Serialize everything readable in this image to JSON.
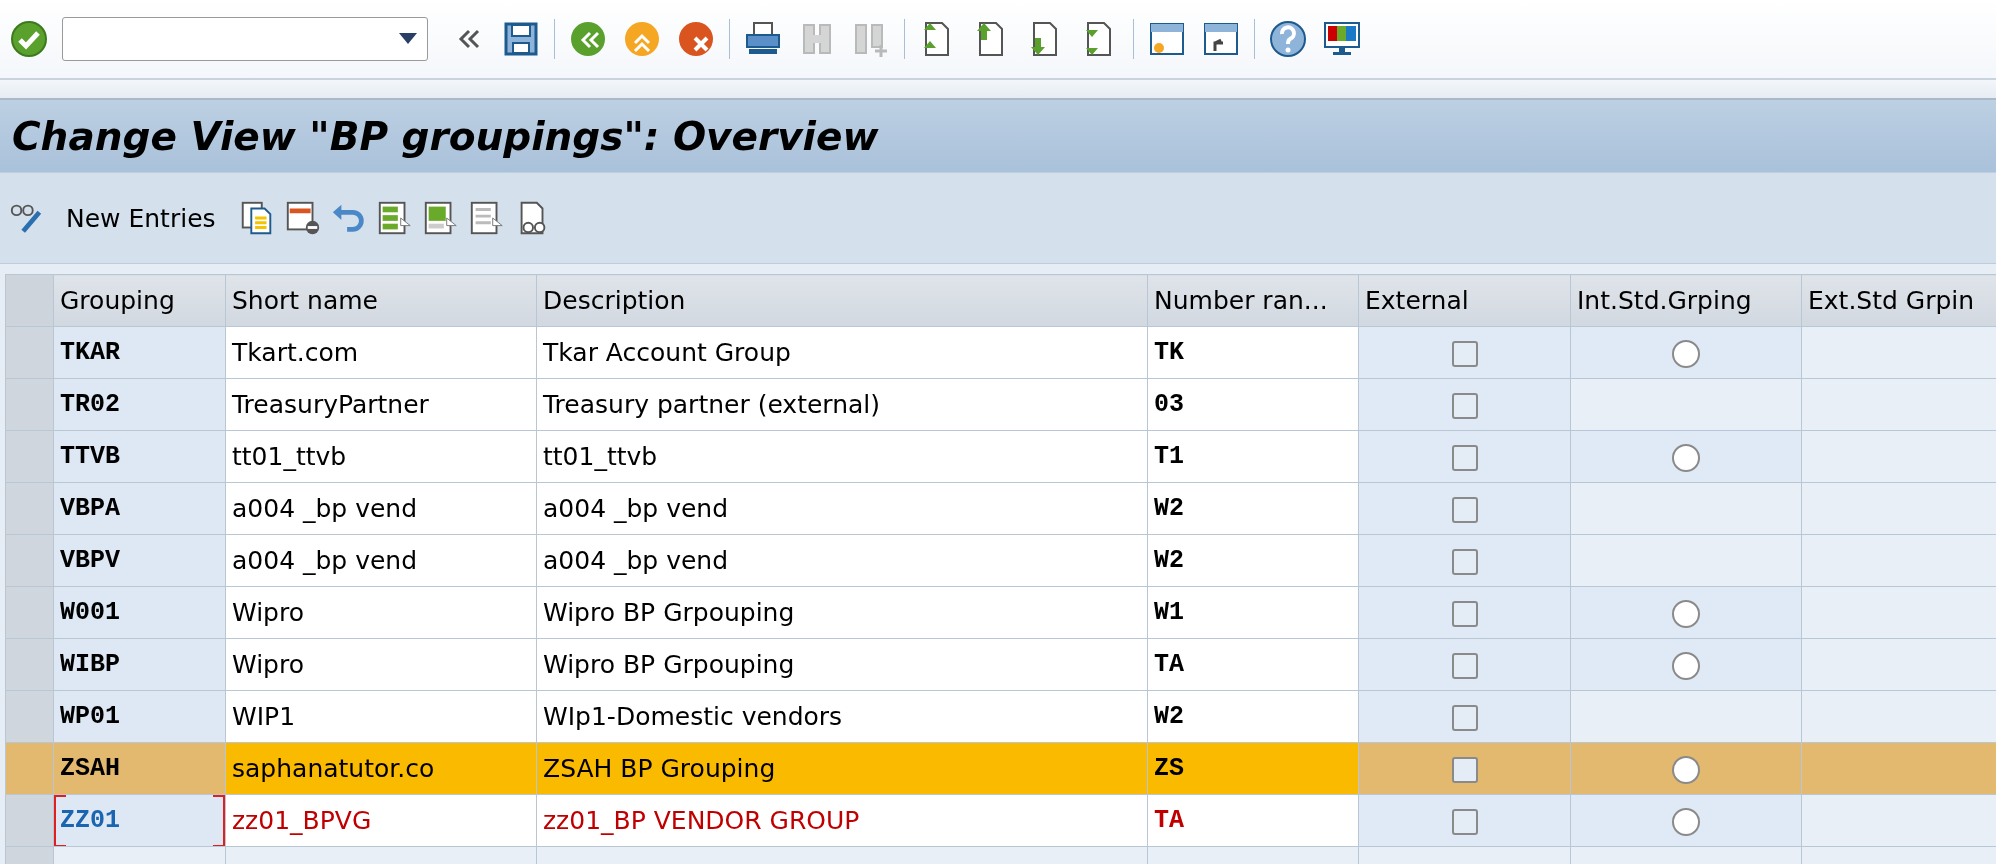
{
  "toolbar": {
    "items": [
      {
        "kind": "enter",
        "disabled": false
      },
      {
        "kind": "command_field"
      },
      {
        "kind": "collapse",
        "disabled": false
      },
      {
        "kind": "save",
        "disabled": false
      },
      {
        "kind": "separator"
      },
      {
        "kind": "back",
        "disabled": false
      },
      {
        "kind": "exit",
        "disabled": false
      },
      {
        "kind": "cancel",
        "disabled": false
      },
      {
        "kind": "separator"
      },
      {
        "kind": "print",
        "disabled": false
      },
      {
        "kind": "find",
        "disabled": true
      },
      {
        "kind": "find_next",
        "disabled": true
      },
      {
        "kind": "separator"
      },
      {
        "kind": "first_page",
        "disabled": false
      },
      {
        "kind": "prev_page",
        "disabled": false
      },
      {
        "kind": "next_page",
        "disabled": false
      },
      {
        "kind": "last_page",
        "disabled": false
      },
      {
        "kind": "separator"
      },
      {
        "kind": "new_session",
        "disabled": false
      },
      {
        "kind": "shortcut",
        "disabled": false
      },
      {
        "kind": "separator"
      },
      {
        "kind": "help",
        "disabled": false
      },
      {
        "kind": "layout",
        "disabled": false
      }
    ]
  },
  "title": "Change View \"BP groupings\": Overview",
  "app_toolbar": {
    "items": [
      {
        "kind": "display_change"
      },
      {
        "kind": "text_button",
        "label": "New Entries"
      },
      {
        "kind": "copy"
      },
      {
        "kind": "delete"
      },
      {
        "kind": "undo"
      },
      {
        "kind": "select_all"
      },
      {
        "kind": "select_block"
      },
      {
        "kind": "deselect_all"
      },
      {
        "kind": "where_used"
      }
    ]
  },
  "table": {
    "columns": [
      "Grouping",
      "Short name",
      "Description",
      "Number ran...",
      "External",
      "Int.Std.Grping",
      "Ext.Std Grpin"
    ],
    "rows": [
      {
        "grouping": "TKAR",
        "short_name": "Tkart.com",
        "description": "Tkar Account Group",
        "number_range": "TK",
        "external": false,
        "int_std": {
          "selected": false
        },
        "selected": false,
        "changed": false,
        "focused": false
      },
      {
        "grouping": "TR02",
        "short_name": "TreasuryPartner",
        "description": "Treasury partner (external)",
        "number_range": "03",
        "external": false,
        "selected": false,
        "changed": false,
        "focused": false
      },
      {
        "grouping": "TTVB",
        "short_name": "tt01_ttvb",
        "description": "tt01_ttvb",
        "number_range": "T1",
        "external": false,
        "int_std": {
          "selected": false
        },
        "selected": false,
        "changed": false,
        "focused": false
      },
      {
        "grouping": "VBPA",
        "short_name": "a004 _bp vend",
        "description": "a004 _bp vend",
        "number_range": "W2",
        "external": false,
        "selected": false,
        "changed": false,
        "focused": false
      },
      {
        "grouping": "VBPV",
        "short_name": "a004 _bp vend",
        "description": "a004 _bp vend",
        "number_range": "W2",
        "external": false,
        "selected": false,
        "changed": false,
        "focused": false
      },
      {
        "grouping": "W001",
        "short_name": "Wipro",
        "description": "Wipro BP Grpouping",
        "number_range": "W1",
        "external": false,
        "int_std": {
          "selected": false
        },
        "selected": false,
        "changed": false,
        "focused": false
      },
      {
        "grouping": "WIBP",
        "short_name": "Wipro",
        "description": "Wipro BP Grpouping",
        "number_range": "TA",
        "external": false,
        "int_std": {
          "selected": false
        },
        "selected": false,
        "changed": false,
        "focused": false
      },
      {
        "grouping": "WP01",
        "short_name": "WIP1",
        "description": "WIp1-Domestic vendors",
        "number_range": "W2",
        "external": false,
        "selected": false,
        "changed": false,
        "focused": false
      },
      {
        "grouping": "ZSAH",
        "short_name": "saphanatutor.co",
        "description": "ZSAH BP Grouping",
        "number_range": "ZS",
        "external": false,
        "int_std": {
          "selected": false
        },
        "selected": true,
        "changed": false,
        "focused": false
      },
      {
        "grouping": "ZZ01",
        "short_name": "zz01_BPVG",
        "description": "zz01_BP VENDOR GROUP",
        "number_range": "TA",
        "external": false,
        "int_std": {
          "selected": false
        },
        "selected": false,
        "changed": true,
        "focused": true
      }
    ]
  }
}
